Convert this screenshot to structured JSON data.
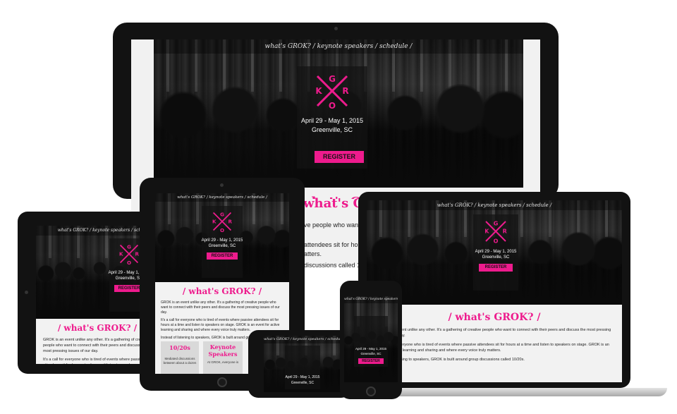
{
  "site": {
    "nav": "what's GROK? / keynote speakers / schedule /",
    "logo_letters": [
      "G",
      "R",
      "O",
      "K"
    ],
    "date": "April 29 - May 1, 2015",
    "city": "Greenville, SC",
    "register": "REGISTER",
    "heading": "/ what's GROK? /",
    "heading_desktop": "what's GROK?",
    "p1": "GROK is an event unlike any other. It's a gathering of creative people who want to connect with their peers and discuss the most pressing issues of our day.",
    "p2": "It's a call for everyone who is tired of events where passive attendees sit for hours at a time and listen to speakers on stage. GROK is an event for active learning and sharing and where every voice truly matters.",
    "p3": "Instead of listening to speakers, GROK is built around group discussions called 10/20s.",
    "cards": [
      {
        "title": "10/20s",
        "body": "Mediated discussions between about a dozen"
      },
      {
        "title": "Keynote Speakers",
        "body": "At GROK, everyone is"
      }
    ]
  },
  "desktop_fragments": {
    "p1_tail": "ve people who want to co",
    "p2_tail_a": "attendees sit for hours a",
    "p2_tail_b": "atters.",
    "p3_tail": "discussions called 10/2"
  },
  "colors": {
    "accent": "#ee1b8d",
    "bezel": "#121212",
    "laptop_silver": "#d6d6d6"
  }
}
